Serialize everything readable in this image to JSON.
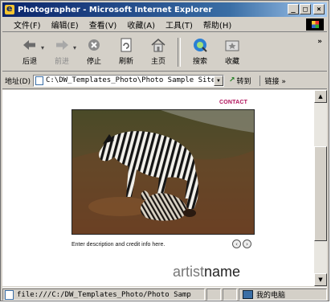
{
  "window": {
    "title": "Photographer - Microsoft Internet Explorer",
    "buttons": [
      "_",
      "□",
      "×"
    ]
  },
  "menu": {
    "items": [
      "文件(F)",
      "编辑(E)",
      "查看(V)",
      "收藏(A)",
      "工具(T)",
      "帮助(H)"
    ]
  },
  "toolbar": {
    "back": "后退",
    "forward": "前进",
    "stop": "停止",
    "refresh": "刷新",
    "home": "主页",
    "search": "搜索",
    "favorites": "收藏",
    "more": "»"
  },
  "address": {
    "label": "地址(D)",
    "value": "C:\\DW_Templates_Photo\\Photo Sample Site\\",
    "go": "转到",
    "links": "链接 »"
  },
  "page": {
    "contact": "CONTACT",
    "caption": "Enter description and credit info here.",
    "prev": "‹",
    "next": "›",
    "artist_first": "artist",
    "artist_last": "name"
  },
  "status": {
    "text": "file:///C:/DW_Templates_Photo/Photo Samp",
    "zone": "我的电脑"
  },
  "colors": {
    "title_start": "#0a246a",
    "contact": "#b0105a"
  }
}
